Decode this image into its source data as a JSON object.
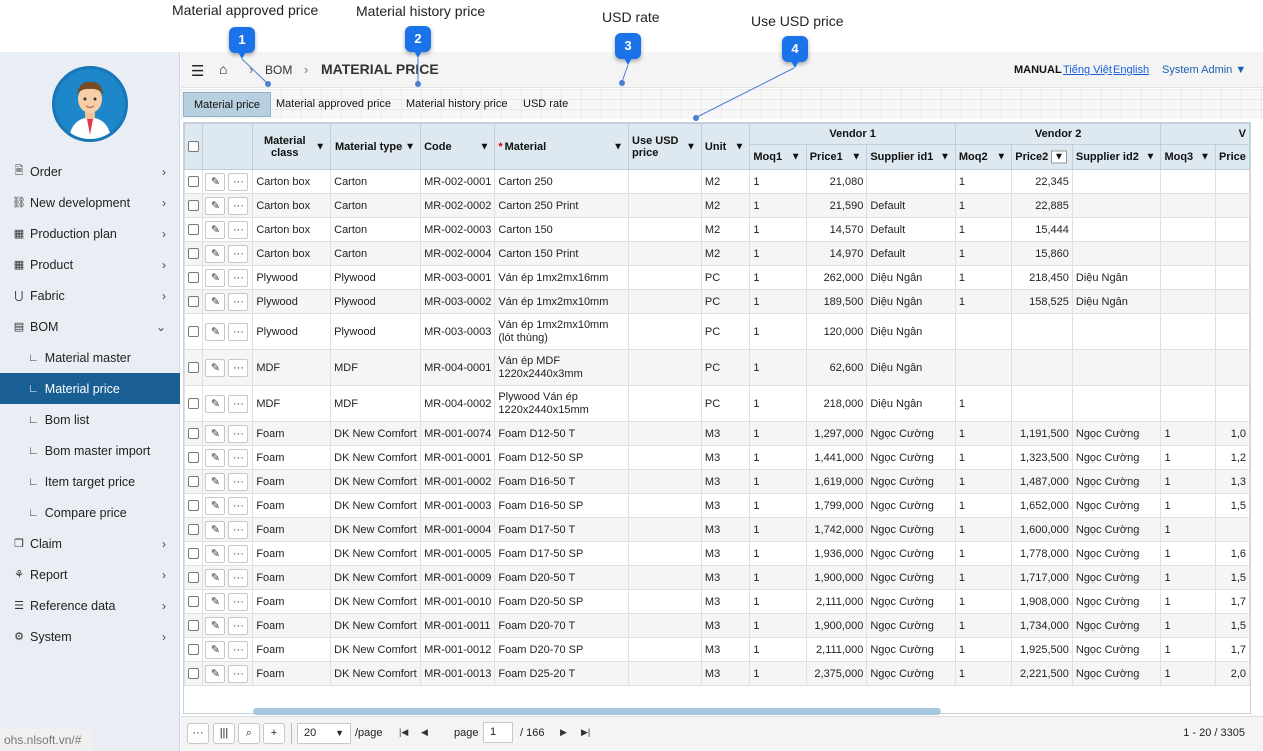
{
  "annotations": [
    {
      "num": "1",
      "label": "Material approved price"
    },
    {
      "num": "2",
      "label": "Material history price"
    },
    {
      "num": "3",
      "label": "USD rate"
    },
    {
      "num": "4",
      "label": "Use USD price"
    }
  ],
  "header": {
    "breadcrumb": "BOM",
    "page_title": "MATERIAL PRICE",
    "manual": "MANUAL",
    "lang_vi": "Tiếng Việt",
    "lang_en": "English",
    "user": "System Admin ▼"
  },
  "sidebar": {
    "items": [
      {
        "label": "Order",
        "icon": "file-icon",
        "glyph": "🗎"
      },
      {
        "label": "New development",
        "icon": "link-icon",
        "glyph": "⛓"
      },
      {
        "label": "Production plan",
        "icon": "grid-icon",
        "glyph": "▦"
      },
      {
        "label": "Product",
        "icon": "grid-icon",
        "glyph": "▦"
      },
      {
        "label": "Fabric",
        "icon": "magnet-icon",
        "glyph": "⋃"
      },
      {
        "label": "BOM",
        "icon": "table-icon",
        "glyph": "▤"
      }
    ],
    "bom_subitems": [
      "Material master",
      "Material price",
      "Bom list",
      "Bom master import",
      "Item target price",
      "Compare price"
    ],
    "items_after": [
      {
        "label": "Claim",
        "icon": "copy-icon",
        "glyph": "❐"
      },
      {
        "label": "Report",
        "icon": "sitemap-icon",
        "glyph": "⚘"
      },
      {
        "label": "Reference data",
        "icon": "database-icon",
        "glyph": "☰"
      },
      {
        "label": "System",
        "icon": "gear-icon",
        "glyph": "⚙"
      }
    ],
    "status_url": "ohs.nlsoft.vn/#"
  },
  "tabs": [
    "Material price",
    "Material approved price",
    "Material history price",
    "USD rate"
  ],
  "grid": {
    "headers": {
      "material_class": "Material class",
      "material_type": "Material type",
      "code": "Code",
      "material": "Material",
      "use_usd": "Use USD price",
      "unit": "Unit",
      "vendor1": "Vendor 1",
      "vendor2": "Vendor 2",
      "vendor3": "V",
      "moq1": "Moq1",
      "price1": "Price1",
      "supplier1": "Supplier id1",
      "moq2": "Moq2",
      "price2": "Price2",
      "supplier2": "Supplier id2",
      "moq3": "Moq3",
      "price3": "Price"
    },
    "rows": [
      [
        "Carton box",
        "Carton",
        "MR-002-0001",
        "Carton 250",
        "",
        "M2",
        "1",
        "21,080",
        "",
        "1",
        "22,345",
        "",
        "",
        ""
      ],
      [
        "Carton box",
        "Carton",
        "MR-002-0002",
        "Carton 250 Print",
        "",
        "M2",
        "1",
        "21,590",
        "Default",
        "1",
        "22,885",
        "",
        "",
        ""
      ],
      [
        "Carton box",
        "Carton",
        "MR-002-0003",
        "Carton 150",
        "",
        "M2",
        "1",
        "14,570",
        "Default",
        "1",
        "15,444",
        "",
        "",
        ""
      ],
      [
        "Carton box",
        "Carton",
        "MR-002-0004",
        "Carton 150 Print",
        "",
        "M2",
        "1",
        "14,970",
        "Default",
        "1",
        "15,860",
        "",
        "",
        ""
      ],
      [
        "Plywood",
        "Plywood",
        "MR-003-0001",
        "Ván ép 1mx2mx16mm",
        "",
        "PC",
        "1",
        "262,000",
        "Diệu Ngân",
        "1",
        "218,450",
        "Diệu Ngân",
        "",
        ""
      ],
      [
        "Plywood",
        "Plywood",
        "MR-003-0002",
        "Ván ép 1mx2mx10mm",
        "",
        "PC",
        "1",
        "189,500",
        "Diệu Ngân",
        "1",
        "158,525",
        "Diệu Ngân",
        "",
        ""
      ],
      [
        "Plywood",
        "Plywood",
        "MR-003-0003",
        "Ván ép 1mx2mx10mm (lót thùng)",
        "",
        "PC",
        "1",
        "120,000",
        "Diệu Ngân",
        "",
        "",
        "",
        "",
        ""
      ],
      [
        "MDF",
        "MDF",
        "MR-004-0001",
        "Ván ép MDF 1220x2440x3mm",
        "",
        "PC",
        "1",
        "62,600",
        "Diệu Ngân",
        "",
        "",
        "",
        "",
        ""
      ],
      [
        "MDF",
        "MDF",
        "MR-004-0002",
        "Plywood Ván ép 1220x2440x15mm",
        "",
        "PC",
        "1",
        "218,000",
        "Diệu Ngân",
        "1",
        "",
        "",
        "",
        ""
      ],
      [
        "Foam",
        "DK New Comfort",
        "MR-001-0074",
        "Foam D12-50 T",
        "",
        "M3",
        "1",
        "1,297,000",
        "Ngọc Cường",
        "1",
        "1,191,500",
        "Ngọc Cường",
        "1",
        "1,0"
      ],
      [
        "Foam",
        "DK New Comfort",
        "MR-001-0001",
        "Foam D12-50 SP",
        "",
        "M3",
        "1",
        "1,441,000",
        "Ngọc Cường",
        "1",
        "1,323,500",
        "Ngọc Cường",
        "1",
        "1,2"
      ],
      [
        "Foam",
        "DK New Comfort",
        "MR-001-0002",
        "Foam D16-50 T",
        "",
        "M3",
        "1",
        "1,619,000",
        "Ngọc Cường",
        "1",
        "1,487,000",
        "Ngọc Cường",
        "1",
        "1,3"
      ],
      [
        "Foam",
        "DK New Comfort",
        "MR-001-0003",
        "Foam D16-50 SP",
        "",
        "M3",
        "1",
        "1,799,000",
        "Ngọc Cường",
        "1",
        "1,652,000",
        "Ngọc Cường",
        "1",
        "1,5"
      ],
      [
        "Foam",
        "DK New Comfort",
        "MR-001-0004",
        "Foam D17-50 T",
        "",
        "M3",
        "1",
        "1,742,000",
        "Ngọc Cường",
        "1",
        "1,600,000",
        "Ngọc Cường",
        "1",
        ""
      ],
      [
        "Foam",
        "DK New Comfort",
        "MR-001-0005",
        "Foam D17-50 SP",
        "",
        "M3",
        "1",
        "1,936,000",
        "Ngọc Cường",
        "1",
        "1,778,000",
        "Ngọc Cường",
        "1",
        "1,6"
      ],
      [
        "Foam",
        "DK New Comfort",
        "MR-001-0009",
        "Foam D20-50 T",
        "",
        "M3",
        "1",
        "1,900,000",
        "Ngọc Cường",
        "1",
        "1,717,000",
        "Ngọc Cường",
        "1",
        "1,5"
      ],
      [
        "Foam",
        "DK New Comfort",
        "MR-001-0010",
        "Foam D20-50 SP",
        "",
        "M3",
        "1",
        "2,111,000",
        "Ngọc Cường",
        "1",
        "1,908,000",
        "Ngọc Cường",
        "1",
        "1,7"
      ],
      [
        "Foam",
        "DK New Comfort",
        "MR-001-0011",
        "Foam D20-70 T",
        "",
        "M3",
        "1",
        "1,900,000",
        "Ngọc Cường",
        "1",
        "1,734,000",
        "Ngọc Cường",
        "1",
        "1,5"
      ],
      [
        "Foam",
        "DK New Comfort",
        "MR-001-0012",
        "Foam D20-70 SP",
        "",
        "M3",
        "1",
        "2,111,000",
        "Ngọc Cường",
        "1",
        "1,925,500",
        "Ngọc Cường",
        "1",
        "1,7"
      ],
      [
        "Foam",
        "DK New Comfort",
        "MR-001-0013",
        "Foam D25-20 T",
        "",
        "M3",
        "1",
        "2,375,000",
        "Ngọc Cường",
        "1",
        "2,221,500",
        "Ngọc Cường",
        "1",
        "2,0"
      ]
    ]
  },
  "pager": {
    "page_size": "20",
    "per_page": "/page",
    "page_label": "page",
    "current_page": "1",
    "total_pages": "/ 166",
    "range": "1 - 20 / 3305"
  }
}
